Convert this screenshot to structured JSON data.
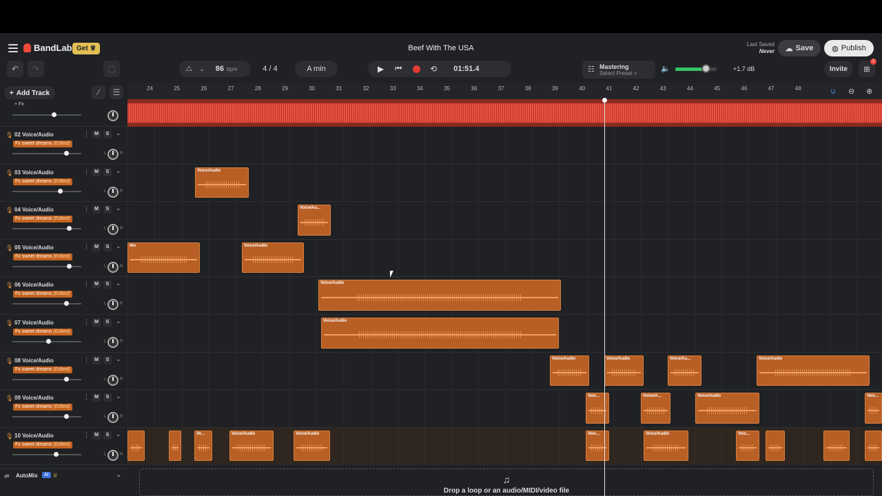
{
  "app": {
    "logo": "BandLab",
    "get_label": "Get",
    "title": "Beef With The USA",
    "last_saved_label": "Last Saved",
    "last_saved_value": "Never",
    "save_label": "Save",
    "publish_label": "Publish"
  },
  "toolbar": {
    "bpm": "86",
    "bpm_unit": "bpm",
    "time_sig": "4 / 4",
    "key": "A min",
    "time": "01:51.4",
    "mastering_title": "Mastering",
    "mastering_sub": "Select Preset >",
    "db": "+1.7 dB",
    "invite_label": "Invite",
    "gift_badge": "1"
  },
  "add_track_label": "Add Track",
  "ruler": [
    "24",
    "25",
    "26",
    "27",
    "28",
    "29",
    "30",
    "31",
    "32",
    "33",
    "34",
    "35",
    "36",
    "37",
    "38",
    "39",
    "40",
    "41",
    "42",
    "43",
    "44",
    "45",
    "46",
    "47",
    "48"
  ],
  "master_label": "+ Fx",
  "tracks": [
    {
      "num": "02",
      "name": "Voice/Audio",
      "fx": "Fx sweet dreams",
      "edited": "(Edited)"
    },
    {
      "num": "03",
      "name": "Voice/Audio",
      "fx": "Fx sweet dreams",
      "edited": "(Edited)"
    },
    {
      "num": "04",
      "name": "Voice/Audio",
      "fx": "Fx sweet dreams",
      "edited": "(Edited)"
    },
    {
      "num": "05",
      "name": "Voice/Audio",
      "fx": "Fx sweet dreams",
      "edited": "(Edited)"
    },
    {
      "num": "06",
      "name": "Voice/Audio",
      "fx": "Fx sweet dreams",
      "edited": "(Edited)"
    },
    {
      "num": "07",
      "name": "Voice/Audio",
      "fx": "Fx sweet dreams",
      "edited": "(Edited)"
    },
    {
      "num": "08",
      "name": "Voice/Audio",
      "fx": "Fx sweet dreams",
      "edited": "(Edited)"
    },
    {
      "num": "09",
      "name": "Voice/Audio",
      "fx": "Fx sweet dreams",
      "edited": "(Edited)"
    },
    {
      "num": "10",
      "name": "Voice/Audio",
      "fx": "Fx sweet dreams",
      "edited": "(Edited)"
    }
  ],
  "track_controls": {
    "mute": "M",
    "solo": "S",
    "pan_left": "L",
    "pan_right": "R"
  },
  "clip_labels": {
    "full": "Voice/Audio",
    "short1": "Voice/Au...",
    "short2": "Voic...",
    "short3": "Voice/A...",
    "short4": "Vo...",
    "short5": "Voice/Au...",
    "edge": "dio"
  },
  "automix": {
    "label": "AutoMix",
    "badge": "AI"
  },
  "drop_text": "Drop a loop or an audio/MIDI/video file"
}
